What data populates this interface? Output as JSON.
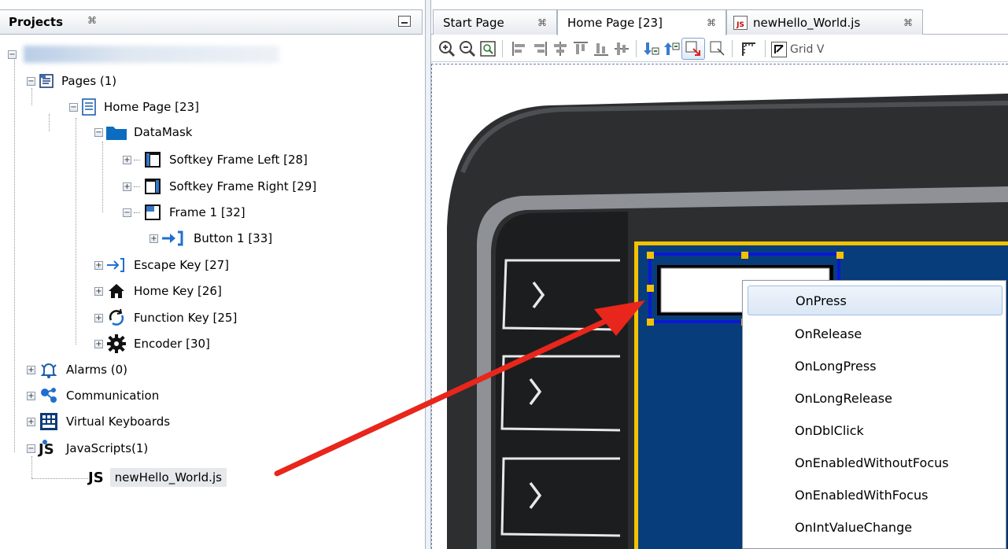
{
  "projects_panel": {
    "title": "Projects",
    "close_glyph": "⌘",
    "tree": {
      "root_label_blurred": "",
      "pages": "Pages (1)",
      "home_page": "Home Page [23]",
      "datamask": "DataMask",
      "softkey_left": "Softkey Frame Left [28]",
      "softkey_right": "Softkey Frame Right [29]",
      "frame1": "Frame 1 [32]",
      "button1": "Button 1 [33]",
      "escape_key": "Escape Key [27]",
      "home_key": "Home Key [26]",
      "function_key": "Function Key [25]",
      "encoder": "Encoder [30]",
      "alarms": "Alarms (0)",
      "communication": "Communication",
      "virtual_keyboards": "Virtual Keyboards",
      "javascripts": "JavaScripts(1)",
      "js_file": "newHello_World.js"
    }
  },
  "editor": {
    "tabs": [
      {
        "label": "Start Page",
        "close": "⌘"
      },
      {
        "label": "Home Page [23]",
        "close": "⌘"
      },
      {
        "label": "newHello_World.js",
        "close": "⌘"
      }
    ],
    "toolbar": {
      "grid_label": "Grid V"
    }
  },
  "context_menu": {
    "items": [
      "OnPress",
      "OnRelease",
      "OnLongPress",
      "OnLongRelease",
      "OnDblClick",
      "OnEnabledWithoutFocus",
      "OnEnabledWithFocus",
      "OnIntValueChange"
    ]
  },
  "colors": {
    "screen_blue": "#083d7b",
    "device_body": "#2c2d2f",
    "arrow": "#e8261b",
    "selection_handle": "#f2c200",
    "hover_bg": "#dbe7f6"
  }
}
